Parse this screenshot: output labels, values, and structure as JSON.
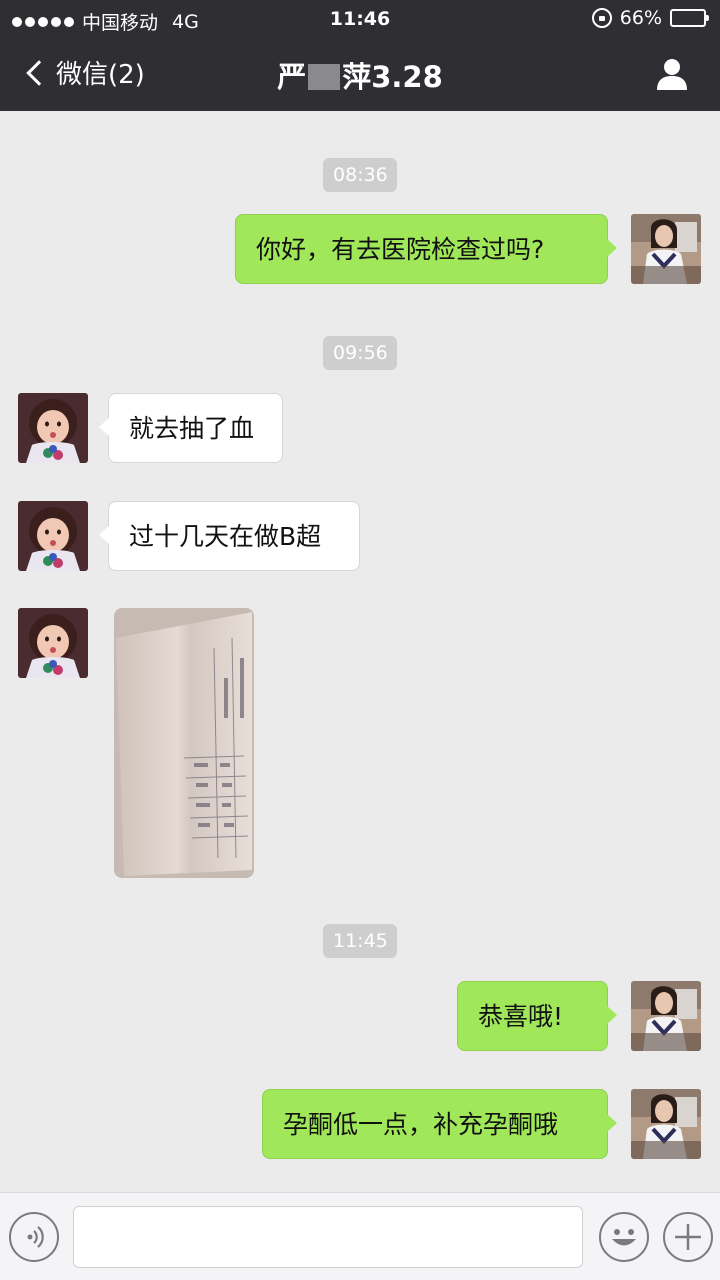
{
  "status_bar": {
    "carrier": "中国移动",
    "network": "4G",
    "time": "11:46",
    "battery_percent": "66%",
    "battery_level": 0.66
  },
  "nav": {
    "back_label": "微信(2)",
    "title_prefix": "严",
    "title_suffix": "萍3.28"
  },
  "messages": {
    "ts1": "08:36",
    "m1": "你好，有去医院检查过吗?",
    "ts2": "09:56",
    "m2": "就去抽了血",
    "m3": "过十几天在做B超",
    "ts3": "11:45",
    "m5": "恭喜哦!",
    "m6": "孕酮低一点，补充孕酮哦"
  },
  "input": {
    "placeholder": ""
  },
  "icons": [
    "back-chevron-icon",
    "profile-icon",
    "voice-icon",
    "emoji-icon",
    "plus-icon",
    "lock-icon",
    "battery-icon"
  ],
  "colors": {
    "topbar": "#2e2e33",
    "background": "#ebebeb",
    "outgoing_bubble": "#a0e75a",
    "incoming_bubble": "#ffffff"
  }
}
